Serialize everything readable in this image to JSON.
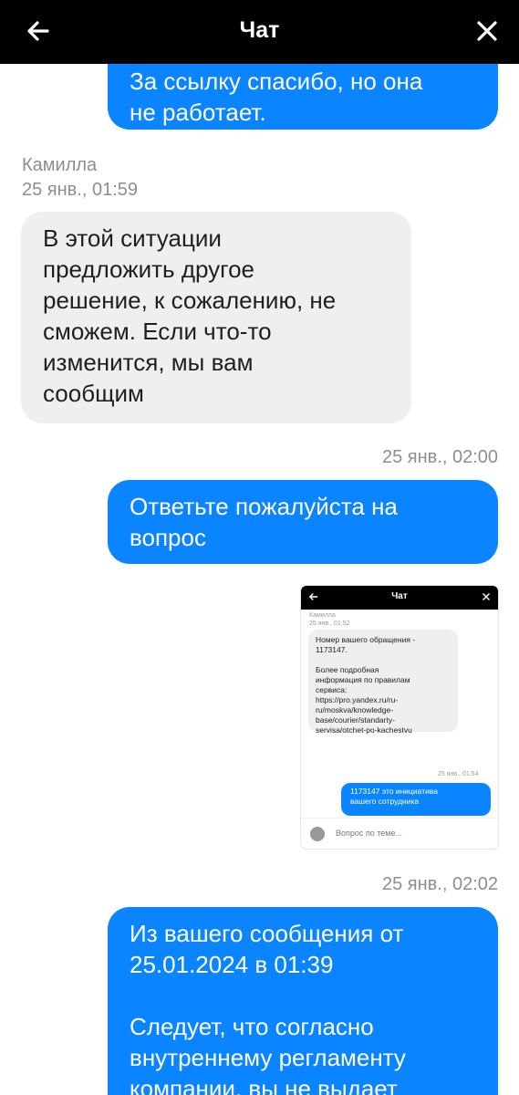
{
  "header": {
    "title": "Чат",
    "back_icon": "arrow-left-icon",
    "close_icon": "close-icon"
  },
  "messages": {
    "m1": [
      "За ссылку спасибо, но она",
      "не работает."
    ],
    "m2_sender": "Камилла",
    "m2_time": "25 янв., 01:59",
    "m2": [
      "В этой ситуации",
      "предложить другое",
      "решение, к сожалению, не",
      "сможем. Если что-то",
      "изменится, мы вам",
      "сообщим"
    ],
    "m3_time": "25 янв., 02:00",
    "m3": [
      "Ответьте пожалуйста на",
      "вопрос"
    ],
    "m4_time": "25 янв., 02:02",
    "m5": [
      "Из вашего сообщения от",
      "25.01.2024 в 01:39",
      "",
      "Следует, что согласно",
      "внутреннему регламенту",
      "компании, вы не выдает"
    ]
  },
  "attachment": {
    "title": "Чат",
    "sender": "Камилла",
    "time1": "25 янв., 01:52",
    "in_text": [
      "Номер вашего обращения -",
      "1173147.",
      "",
      "Более подробная",
      "информация по правилам",
      "сервиса:",
      "https://pro.yandex.ru/ru-",
      "ru/moskva/knowledge-",
      "base/courier/standarty-",
      "servisa/otchet-po-kachestvu"
    ],
    "time2": "25 янв., 01:54",
    "out_text": [
      "1173147 это инициатива",
      "вашего сотрудника"
    ],
    "input_placeholder": "Вопрос по теме..."
  }
}
